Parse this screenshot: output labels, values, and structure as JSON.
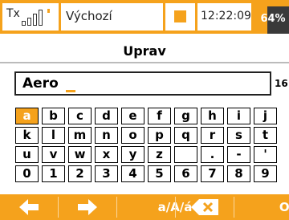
{
  "status": {
    "tx_label": "Tx",
    "profile": "Výchozí",
    "time": "12:22:09",
    "battery": "64%",
    "battery_level": 0.64,
    "signal_icon": "signal-bars-icon",
    "accent": "#f5a21c"
  },
  "title": "Uprav",
  "input": {
    "value": "Aero",
    "char_count": "16"
  },
  "keyboard": {
    "rows": [
      [
        "a",
        "b",
        "c",
        "d",
        "e",
        "f",
        "g",
        "h",
        "i",
        "j"
      ],
      [
        "k",
        "l",
        "m",
        "n",
        "o",
        "p",
        "q",
        "r",
        "s",
        "t"
      ],
      [
        "u",
        "v",
        "w",
        "x",
        "y",
        "z",
        "",
        ".",
        "-",
        "'"
      ],
      [
        "0",
        "1",
        "2",
        "3",
        "4",
        "5",
        "6",
        "7",
        "8",
        "9"
      ]
    ],
    "selected": "a"
  },
  "footer": {
    "left_icon": "arrow-left-icon",
    "right_icon": "arrow-right-icon",
    "case_label": "a/A/á",
    "backspace_icon": "backspace-icon",
    "ok_label": "OK"
  }
}
